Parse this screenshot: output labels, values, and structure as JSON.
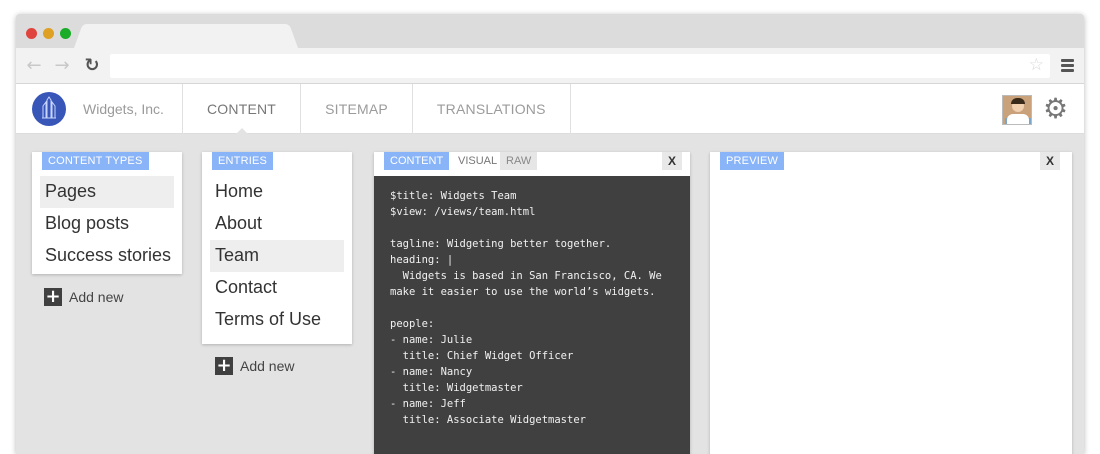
{
  "app": {
    "company_name": "Widgets, Inc.",
    "nav": [
      "CONTENT",
      "SITEMAP",
      "TRANSLATIONS"
    ]
  },
  "content_types": {
    "tag": "CONTENT TYPES",
    "items": [
      "Pages",
      "Blog posts",
      "Success stories"
    ],
    "selected": "Pages",
    "add_label": "Add new"
  },
  "entries": {
    "tag": "ENTRIES",
    "items": [
      "Home",
      "About",
      "Team",
      "Contact",
      "Terms of Use"
    ],
    "selected": "Team",
    "add_label": "Add new"
  },
  "editor": {
    "tabs": [
      "CONTENT",
      "VISUAL",
      "RAW"
    ],
    "close_label": "X",
    "code": "$title: Widgets Team\n$view: /views/team.html\n\ntagline: Widgeting better together.\nheading: |\n  Widgets is based in San Francisco, CA. We\nmake it easier to use the world’s widgets.\n\npeople:\n- name: Julie\n  title: Chief Widget Officer\n- name: Nancy\n  title: Widgetmaster\n- name: Jeff\n  title: Associate Widgetmaster"
  },
  "preview": {
    "tag": "PREVIEW",
    "close_label": "X"
  },
  "icons": {
    "back": "arrow-left-icon",
    "forward": "arrow-right-icon",
    "reload": "reload-icon",
    "star": "star-icon",
    "menu": "hamburger-menu-icon",
    "settings": "gear-icon",
    "add": "plus-icon"
  },
  "colors": {
    "accent": "#8ab4f8",
    "editor_bg": "#404040",
    "logo": "#3856b8"
  }
}
